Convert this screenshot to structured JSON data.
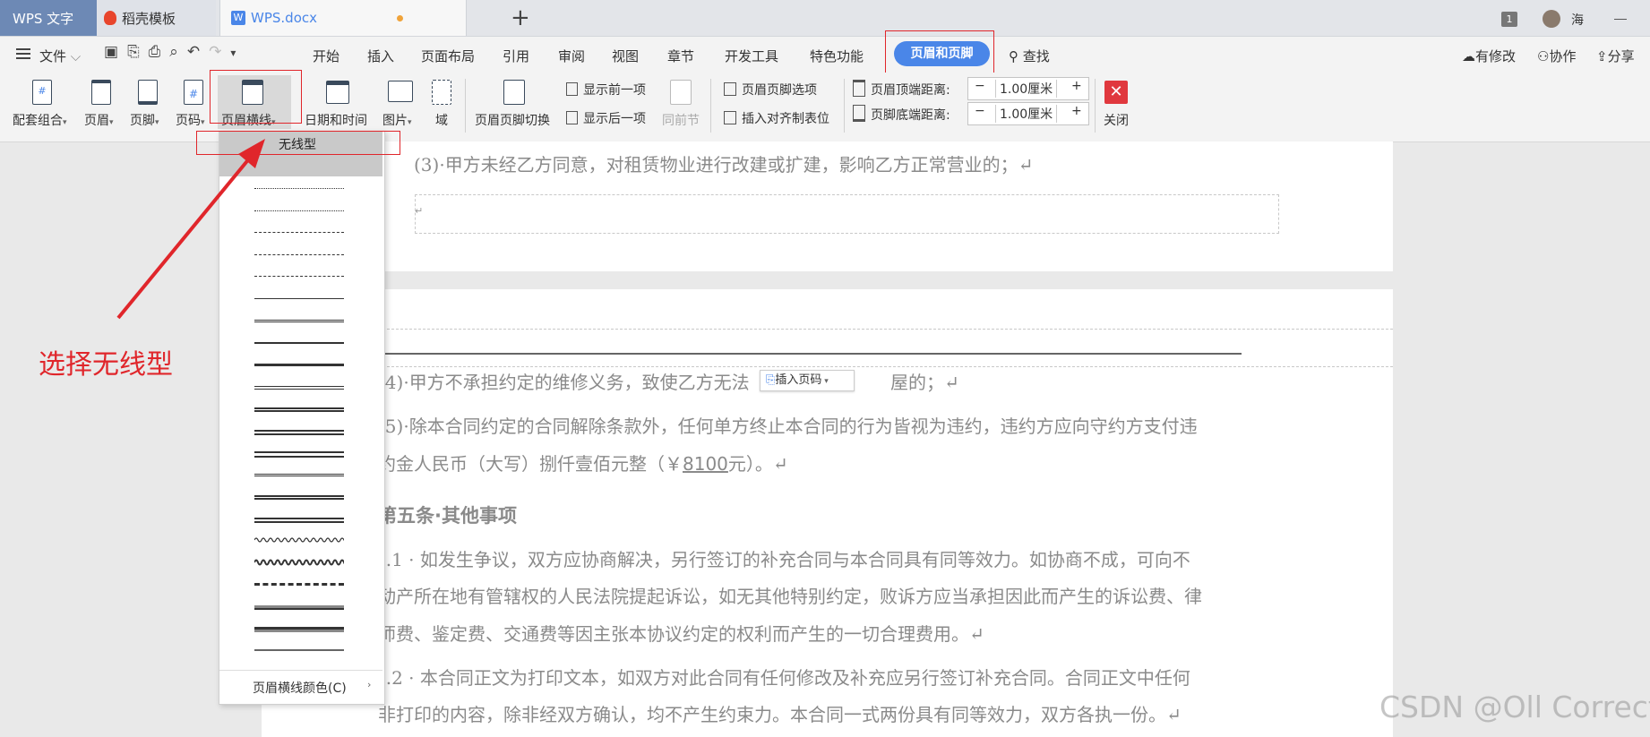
{
  "tabs": {
    "app": "WPS 文字",
    "template": "稻壳模板",
    "doc": "WPS.docx"
  },
  "titlebar_right": {
    "badge": "1",
    "user": "海"
  },
  "menu": {
    "file": "文件",
    "items": [
      "开始",
      "插入",
      "页面布局",
      "引用",
      "审阅",
      "视图",
      "章节",
      "开发工具",
      "特色功能"
    ],
    "active": "页眉和页脚",
    "search": "查找",
    "right": [
      "有修改",
      "协作",
      "分享"
    ]
  },
  "toolbar": {
    "set_combo": "配套组合",
    "header": "页眉",
    "footer": "页脚",
    "page_num": "页码",
    "header_line": "页眉横线",
    "datetime": "日期和时间",
    "picture": "图片",
    "field": "域",
    "switch": "页眉页脚切换",
    "show_prev": "显示前一项",
    "show_next": "显示后一项",
    "same_prev": "同前节",
    "options": "页眉页脚选项",
    "insert_tab": "插入对齐制表位",
    "header_top_label": "页眉顶端距离:",
    "header_top_value": "1.00厘米",
    "footer_bottom_label": "页脚底端距离:",
    "footer_bottom_value": "1.00厘米",
    "close": "关闭"
  },
  "dropdown": {
    "first": "无线型",
    "color": "页眉横线颜色(C)"
  },
  "annotation": "选择无线型",
  "document": {
    "line1": "(3)·甲方未经乙方同意，对租赁物业进行改建或扩建，影响乙方正常营业的；↵",
    "line2": "(4)·甲方不承担约定的维修义务，致使乙方无法",
    "line2b": "屋的；↵",
    "insert_page_num": "插入页码",
    "line3": "(5)·除本合同约定的合同解除条款外，任何单方终止本合同的行为皆视为违约，违约方应向守约方支付违",
    "line4a": "约金人民币（大写）捌仟壹佰元整（￥",
    "line4_amount": "8100",
    "line4b": "元）。↵",
    "heading": "第五条·其他事项",
    "p1a": "5.1 ·  如发生争议，双方应协商解决，另行签订的补充合同与本合同具有同等效力。如协商不成，可向不",
    "p1b": "动产所在地有管辖权的人民法院提起诉讼，如无其他特别约定，败诉方应当承担因此而产生的诉讼费、律",
    "p1c": "师费、鉴定费、交通费等因主张本协议约定的权利而产生的一切合理费用。↵",
    "p2a": "5.2 ·  本合同正文为打印文本，如双方对此合同有任何修改及补充应另行签订补充合同。合同正文中任何",
    "p2b": "非打印的内容，除非经双方确认，均不产生约束力。本合同一式两份具有同等效力，双方各执一份。↵"
  },
  "watermark": "CSDN @Oll Correct",
  "colors": {
    "accent": "#4a86e8",
    "annotation": "#e0262b",
    "wps_tab": "#6d89b5"
  }
}
